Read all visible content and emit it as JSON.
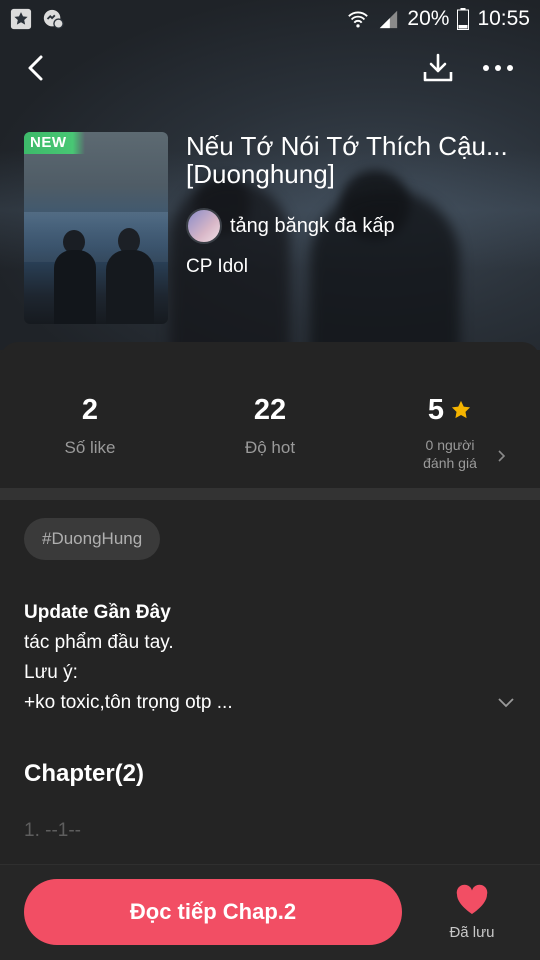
{
  "status_bar": {
    "wifi_icon": "wifi-icon",
    "signal_icon": "signal-icon",
    "battery": "20%",
    "time": "10:55"
  },
  "header": {
    "back_icon": "back-arrow-icon",
    "download_icon": "download-icon",
    "more_icon": "more-dots-icon"
  },
  "story": {
    "badge": "NEW",
    "title": "Nếu Tớ Nói Tớ Thích Cậu... [Duonghung]",
    "author": "tảng băngk đa kấp",
    "category": "CP Idol"
  },
  "stats": {
    "likes": {
      "value": "2",
      "label": "Số like"
    },
    "hot": {
      "value": "22",
      "label": "Độ hot"
    },
    "rating": {
      "value": "5",
      "label_line1": "0 người",
      "label_line2": "đánh giá"
    }
  },
  "tags": [
    "#DuongHung"
  ],
  "description": {
    "heading": "Update Gần Đây",
    "line1": "tác phẩm đầu tay.",
    "line2": "Lưu ý:",
    "line3": "+ko toxic,tôn trọng otp ..."
  },
  "chapters": {
    "title": "Chapter(2)",
    "items": [
      "1. --1--"
    ]
  },
  "bottom": {
    "read_label": "Đọc tiếp Chap.2",
    "save_label": "Đã lưu"
  },
  "colors": {
    "accent": "#f24e64",
    "badge": "#48c774",
    "star": "#f5b400",
    "background": "#242424"
  }
}
